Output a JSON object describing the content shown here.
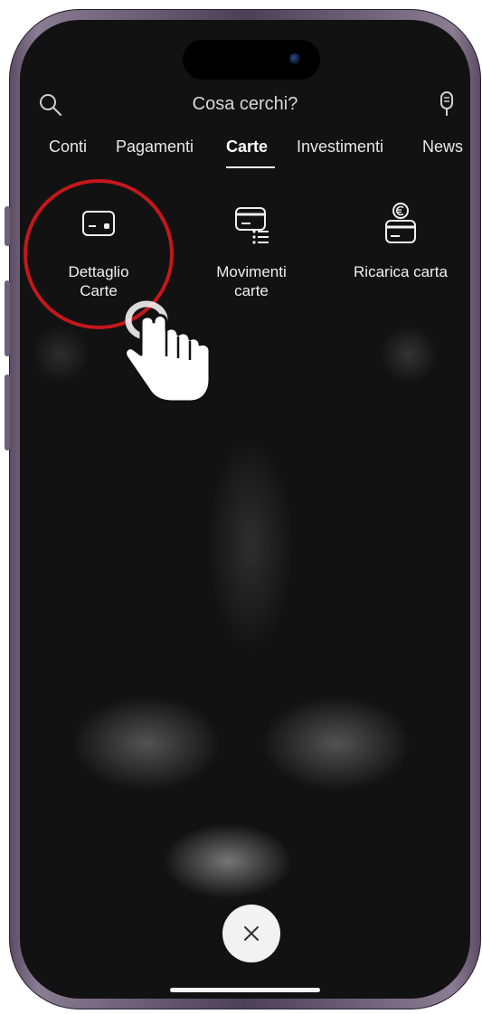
{
  "search": {
    "placeholder": "Cosa cerchi?"
  },
  "tabs": [
    {
      "label": "Conti",
      "active": false
    },
    {
      "label": "Pagamenti",
      "active": false
    },
    {
      "label": "Carte",
      "active": true
    },
    {
      "label": "Investimenti",
      "active": false
    },
    {
      "label": "News",
      "active": false
    }
  ],
  "shortcuts": [
    {
      "label_line1": "Dettaglio",
      "label_line2": "Carte",
      "icon": "card-icon"
    },
    {
      "label_line1": "Movimenti",
      "label_line2": "carte",
      "icon": "card-list-icon"
    },
    {
      "label_line1": "Ricarica carta",
      "label_line2": "",
      "icon": "card-euro-icon"
    }
  ],
  "colors": {
    "highlight": "#c4171c",
    "background": "#121212",
    "text": "#f0f0f0"
  },
  "close": {
    "icon": "close-icon"
  }
}
